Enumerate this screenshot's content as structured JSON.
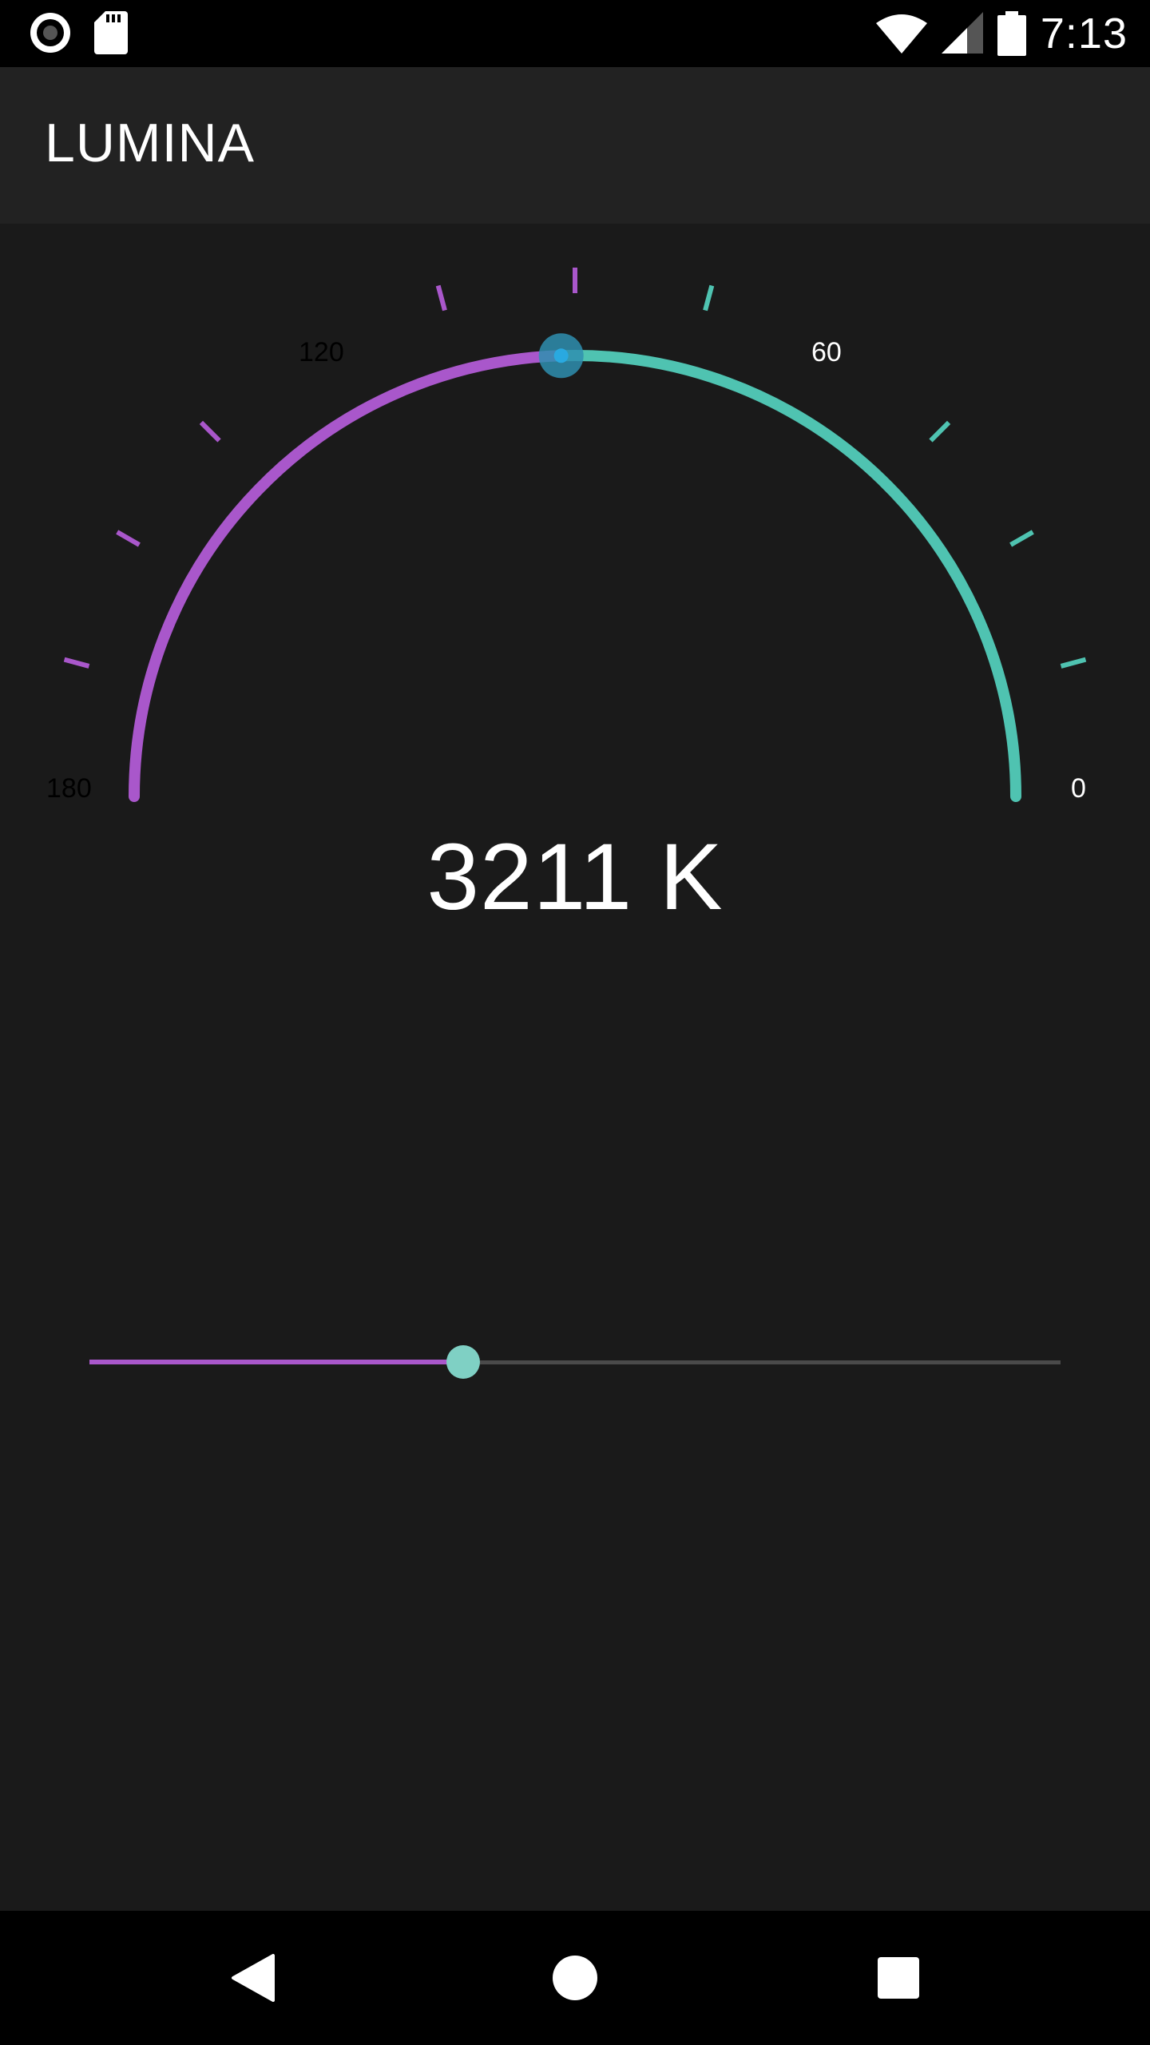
{
  "status_bar": {
    "time": "7:13",
    "left_icons": [
      "radio-button-icon",
      "sd-card-icon"
    ],
    "right_icons": [
      "wifi-icon",
      "cell-signal-icon",
      "battery-icon"
    ]
  },
  "app_bar": {
    "title": "LUMINA"
  },
  "gauge": {
    "tick_labels": [
      "180",
      "120",
      "60",
      "0"
    ],
    "value_position": 0.49,
    "colors": {
      "warm": "#a957cb",
      "cool": "#4fc3b1",
      "thumb": "#2f8fb0"
    }
  },
  "readout": {
    "value_text": "3211 K"
  },
  "slider": {
    "fraction": 0.385,
    "fill_color": "#a957cb",
    "thumb_color": "#7fd0c4"
  },
  "nav_bar": {
    "buttons": [
      "back-icon",
      "home-icon",
      "recents-icon"
    ]
  }
}
